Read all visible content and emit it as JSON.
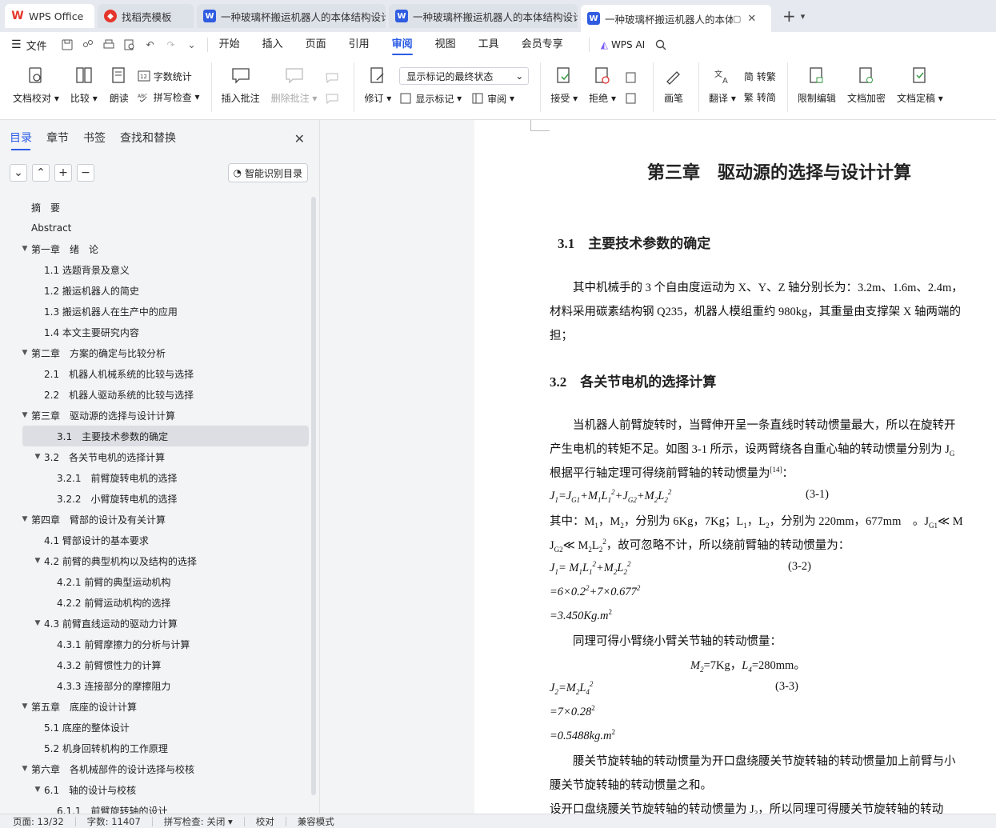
{
  "tabs": [
    {
      "label": "WPS Office",
      "type": "wps"
    },
    {
      "label": "找稻壳模板",
      "type": "docer"
    },
    {
      "label": "一种玻璃杯搬运机器人的本体结构设计",
      "type": "doc"
    },
    {
      "label": "一种玻璃杯搬运机器人的本体结构设计",
      "type": "doc"
    },
    {
      "label": "一种玻璃杯搬运机器人的本体结构",
      "type": "doc"
    }
  ],
  "menu": {
    "file": "文件",
    "items": [
      "开始",
      "插入",
      "页面",
      "引用",
      "审阅",
      "视图",
      "工具",
      "会员专享"
    ],
    "active": "审阅",
    "ai": "WPS AI"
  },
  "ribbon": {
    "proofread": "文档校对",
    "compare": "比较",
    "read_aloud": "朗读",
    "word_count": "字数统计",
    "spell_check": "拼写检查",
    "insert_comment": "插入批注",
    "delete_comment": "删除批注",
    "revise": "修订",
    "markup_select": "显示标记的最终状态",
    "show_markup": "显示标记",
    "review": "审阅",
    "accept": "接受",
    "reject": "拒绝",
    "pen": "画笔",
    "translate": "翻译",
    "to_traditional": "转繁",
    "to_simplified": "转简",
    "restrict_edit": "限制编辑",
    "encrypt": "文档加密",
    "finalize": "文档定稿"
  },
  "sidebar": {
    "tabs": [
      "目录",
      "章节",
      "书签",
      "查找和替换"
    ],
    "smart_btn": "智能识别目录",
    "toc": [
      {
        "label": "摘　要",
        "level": 0,
        "arrow": ""
      },
      {
        "label": "Abstract",
        "level": 0,
        "arrow": ""
      },
      {
        "label": "第一章　绪　论",
        "level": 0,
        "arrow": "▼"
      },
      {
        "label": "1.1 选题背景及意义",
        "level": 1,
        "arrow": ""
      },
      {
        "label": "1.2  搬运机器人的简史",
        "level": 1,
        "arrow": ""
      },
      {
        "label": "1.3 搬运机器人在生产中的应用",
        "level": 1,
        "arrow": ""
      },
      {
        "label": "1.4 本文主要研究内容",
        "level": 1,
        "arrow": ""
      },
      {
        "label": "第二章　方案的确定与比较分析",
        "level": 0,
        "arrow": "▼"
      },
      {
        "label": "2.1　机器人机械系统的比较与选择",
        "level": 1,
        "arrow": ""
      },
      {
        "label": "2.2　机器人驱动系统的比较与选择",
        "level": 1,
        "arrow": ""
      },
      {
        "label": "第三章　驱动源的选择与设计计算",
        "level": 0,
        "arrow": "▼"
      },
      {
        "label": "3.1　主要技术参数的确定",
        "level": 1,
        "arrow": "",
        "selected": true
      },
      {
        "label": "3.2　各关节电机的选择计算",
        "level": 1,
        "arrow": "▼"
      },
      {
        "label": "3.2.1　前臂旋转电机的选择",
        "level": 2,
        "arrow": ""
      },
      {
        "label": "3.2.2　小臂旋转电机的选择",
        "level": 2,
        "arrow": ""
      },
      {
        "label": "第四章　臂部的设计及有关计算",
        "level": 0,
        "arrow": "▼"
      },
      {
        "label": "4.1  臂部设计的基本要求",
        "level": 1,
        "arrow": ""
      },
      {
        "label": "4.2  前臂的典型机构以及结构的选择",
        "level": 1,
        "arrow": "▼"
      },
      {
        "label": "4.2.1  前臂的典型运动机构",
        "level": 2,
        "arrow": ""
      },
      {
        "label": "4.2.2  前臂运动机构的选择",
        "level": 2,
        "arrow": ""
      },
      {
        "label": "4.3  前臂直线运动的驱动力计算",
        "level": 1,
        "arrow": "▼"
      },
      {
        "label": "4.3.1  前臂摩擦力的分析与计算",
        "level": 2,
        "arrow": ""
      },
      {
        "label": "4.3.2  前臂惯性力的计算",
        "level": 2,
        "arrow": ""
      },
      {
        "label": "4.3.3 连接部分的摩擦阻力",
        "level": 2,
        "arrow": ""
      },
      {
        "label": "第五章　底座的设计计算",
        "level": 0,
        "arrow": "▼"
      },
      {
        "label": "5.1  底座的整体设计",
        "level": 1,
        "arrow": ""
      },
      {
        "label": "5.2  机身回转机构的工作原理",
        "level": 1,
        "arrow": ""
      },
      {
        "label": "第六章　各机械部件的设计选择与校核",
        "level": 0,
        "arrow": "▼"
      },
      {
        "label": "6.1　轴的设计与校核",
        "level": 1,
        "arrow": "▼"
      },
      {
        "label": "6.1.1　前臂旋转轴的设计",
        "level": 2,
        "arrow": ""
      }
    ]
  },
  "doc": {
    "chapter_title": "第三章　驱动源的选择与设计计算",
    "h31": "3.1　主要技术参数的确定",
    "p1_l1": "　　其中机械手的 3 个自由度运动为 X、Y、Z 轴分别长为：3.2m、1.6m、2.4m，",
    "p1_l2": "材料采用碳素结构钢 Q235，机器人模组重约 980kg，其重量由支撑架 X 轴两端的",
    "p1_l3": "担；",
    "h32": "3.2　各关节电机的选择计算",
    "p2_l1": "　　当机器人前臂旋转时，当臂伸开呈一条直线时转动惯量最大，所以在旋转开",
    "p2_l2": "产生电机的转矩不足。如图 3-1 所示，设两臂绕各自重心轴的转动惯量分别为 J",
    "p2_l3": "根据平行轴定理可得绕前臂轴的转动惯量为",
    "p2_ref": "[14]",
    "p2_end": "：",
    "eq1_no": "(3-1)",
    "p3_l1": "其中：M",
    "p3_l1b": "，M",
    "p3_l1c": "，分别为 6Kg，7Kg；L",
    "p3_l1d": "，L",
    "p3_l1e": "，分别为 220mm，677mm　。J",
    "p3_l2": "，故可忽略不计，所以绕前臂轴的转动惯量为：",
    "eq2_no": "(3-2)",
    "eq2_l2": "=6×0.2",
    "eq2_l2b": "+7×0.677",
    "eq2_l3": "=3.450Kg.m",
    "p4": "　　同理可得小臂绕小臂关节轴的转动惯量：",
    "p4_eq": "=7Kg，",
    "p4_eq2": "=280mm。",
    "eq3_no": "(3-3)",
    "eq3_l2": "=7×0.28",
    "eq3_l3": "=0.5488kg.m",
    "p5_l1": "　　腰关节旋转轴的转动惯量为开口盘绕腰关节旋转轴的转动惯量加上前臂与小",
    "p5_l2": "腰关节旋转轴的转动惯量之和。",
    "p5_l3": "设开口盘绕腰关节旋转轴的转动惯量为 J",
    "p5_l3b": "，所以同理可得腰关节旋转轴的转动"
  },
  "status": {
    "page": "页面: 13/32",
    "words": "字数: 11407",
    "spell": "拼写检查: 关闭",
    "proof": "校对",
    "compat": "兼容模式"
  },
  "colors": {
    "accent": "#2b5ce6",
    "wps_red": "#e5362b",
    "doc_blue": "#2f5ce0"
  }
}
